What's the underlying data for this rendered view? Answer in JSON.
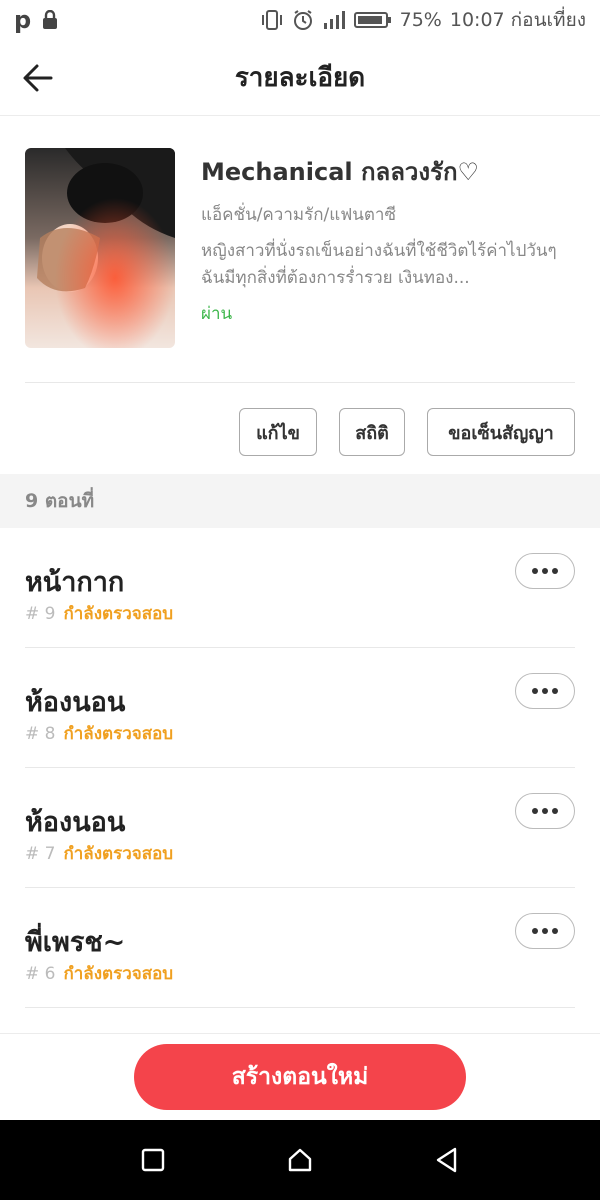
{
  "status_bar": {
    "left_icons": [
      "p-icon",
      "lock-icon"
    ],
    "right_icons": [
      "vibrate-icon",
      "alarm-icon",
      "signal-icon",
      "battery-icon"
    ],
    "battery": "75%",
    "time": "10:07 ก่อนเที่ยง"
  },
  "header": {
    "title": "รายละเอียด",
    "back_icon": "arrow-left-icon"
  },
  "book": {
    "title": "Mechanical กลลวงรัก♡",
    "genre": "แอ็คชั่น/ความรัก/แฟนตาซี",
    "description": "หญิงสาวที่นั่งรถเข็นอย่างฉันที่ใช้ชีวิตไร้ค่าไปวันๆฉันมีทุกสิ่งที่ต้องการร่ำรวย เงินทอง...",
    "status": "ผ่าน",
    "status_color": "#3cb64a"
  },
  "actions": {
    "edit": "แก้ไข",
    "stats": "สถิติ",
    "contract": "ขอเซ็นสัญญา"
  },
  "episode_count": "9 ตอนที่",
  "episodes": [
    {
      "title": "หน้ากาก",
      "number": "# 9",
      "status": "กำลังตรวจสอบ"
    },
    {
      "title": "ห้องนอน",
      "number": "# 8",
      "status": "กำลังตรวจสอบ"
    },
    {
      "title": "ห้องนอน",
      "number": "# 7",
      "status": "กำลังตรวจสอบ"
    },
    {
      "title": "พี่เพรช~",
      "number": "# 6",
      "status": "กำลังตรวจสอบ"
    }
  ],
  "create_button": "สร้างตอนใหม่",
  "colors": {
    "accent": "#f4444b",
    "pending": "#f0a020"
  },
  "nav_icons": [
    "square-icon",
    "home-icon",
    "triangle-back-icon"
  ]
}
